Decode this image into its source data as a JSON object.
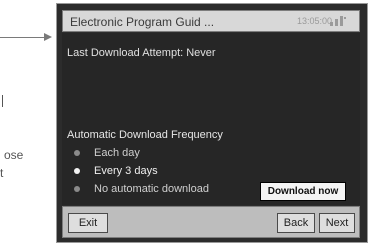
{
  "annotation": {
    "side_text_1": "ose",
    "side_text_2": "t"
  },
  "window": {
    "title": "Electronic Program Guid ...",
    "clock": "13:05:00",
    "title_icon": "signal-icon"
  },
  "content": {
    "status": "Last Download Attempt: Never",
    "frequency_label": "Automatic Download Frequency",
    "options": [
      {
        "label": "Each day",
        "selected": false
      },
      {
        "label": "Every 3 days",
        "selected": true
      },
      {
        "label": "No automatic download",
        "selected": false
      }
    ],
    "download_button": "Download now"
  },
  "footer": {
    "exit": "Exit",
    "back": "Back",
    "next": "Next"
  },
  "colors": {
    "device_bg": "#2c2c2c",
    "titlebar_bg": "#d8d8d8",
    "footer_bg": "#bdbdbd"
  }
}
